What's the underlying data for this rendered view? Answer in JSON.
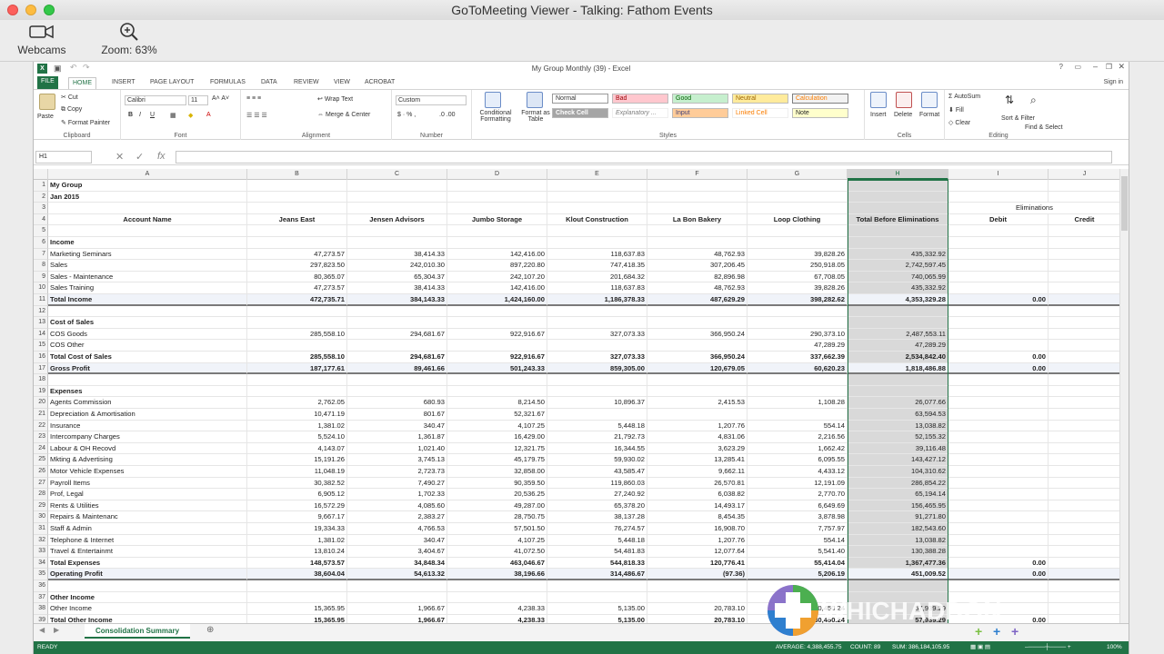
{
  "viewer": {
    "title": "GoToMeeting Viewer - Talking: Fathom Events",
    "webcams_label": "Webcams",
    "zoom_label": "Zoom: 63%"
  },
  "excel": {
    "window_title": "My Group Monthly (39) - Excel",
    "sign_in": "Sign in",
    "tabs": [
      "FILE",
      "HOME",
      "INSERT",
      "PAGE LAYOUT",
      "FORMULAS",
      "DATA",
      "REVIEW",
      "VIEW",
      "ACROBAT"
    ],
    "ribbon": {
      "clipboard": {
        "paste": "Paste",
        "cut": "Cut",
        "copy": "Copy",
        "format_painter": "Format Painter",
        "label": "Clipboard"
      },
      "font": {
        "name": "Calibri",
        "size": "11",
        "label": "Font"
      },
      "alignment": {
        "wrap": "Wrap Text",
        "merge": "Merge & Center",
        "label": "Alignment"
      },
      "number": {
        "format": "Custom",
        "label": "Number"
      },
      "styles": {
        "conditional": "Conditional Formatting",
        "format_table": "Format as Table",
        "normal": "Normal",
        "bad": "Bad",
        "good": "Good",
        "neutral": "Neutral",
        "calculation": "Calculation",
        "check_cell": "Check Cell",
        "explanatory": "Explanatory ...",
        "input": "Input",
        "linked_cell": "Linked Cell",
        "note": "Note",
        "label": "Styles"
      },
      "cells": {
        "insert": "Insert",
        "delete": "Delete",
        "format": "Format",
        "label": "Cells"
      },
      "editing": {
        "autosum": "AutoSum",
        "fill": "Fill",
        "clear": "Clear",
        "sort": "Sort & Filter",
        "find": "Find & Select",
        "label": "Editing"
      }
    },
    "name_box": "H1",
    "columns": [
      "A",
      "B",
      "C",
      "D",
      "E",
      "F",
      "G",
      "H",
      "I",
      "J"
    ],
    "rows": [
      {
        "n": "1",
        "a": "My Group",
        "bold": true
      },
      {
        "n": "2",
        "a": "Jan 2015",
        "bold": true
      },
      {
        "n": "3",
        "i": "Eliminations"
      },
      {
        "n": "4",
        "a": "Account Name",
        "b": "Jeans East",
        "c": "Jensen Advisors",
        "d": "Jumbo Storage",
        "e": "Klout Construction",
        "f": "La Bon Bakery",
        "g": "Loop Clothing",
        "h": "Total Before Eliminations",
        "i": "Debit",
        "j": "Credit",
        "bold": true,
        "header": true
      },
      {
        "n": "5"
      },
      {
        "n": "6",
        "a": "Income",
        "bold": true
      },
      {
        "n": "7",
        "a": "Marketing Seminars",
        "b": "47,273.57",
        "c": "38,414.33",
        "d": "142,416.00",
        "e": "118,637.83",
        "f": "48,762.93",
        "g": "39,828.26",
        "h": "435,332.92"
      },
      {
        "n": "8",
        "a": "Sales",
        "b": "297,823.50",
        "c": "242,010.30",
        "d": "897,220.80",
        "e": "747,418.35",
        "f": "307,206.45",
        "g": "250,918.05",
        "h": "2,742,597.45"
      },
      {
        "n": "9",
        "a": "Sales - Maintenance",
        "b": "80,365.07",
        "c": "65,304.37",
        "d": "242,107.20",
        "e": "201,684.32",
        "f": "82,896.98",
        "g": "67,708.05",
        "h": "740,065.99"
      },
      {
        "n": "10",
        "a": "Sales Training",
        "b": "47,273.57",
        "c": "38,414.33",
        "d": "142,416.00",
        "e": "118,637.83",
        "f": "48,762.93",
        "g": "39,828.26",
        "h": "435,332.92"
      },
      {
        "n": "11",
        "a": "Total Income",
        "b": "472,735.71",
        "c": "384,143.33",
        "d": "1,424,160.00",
        "e": "1,186,378.33",
        "f": "487,629.29",
        "g": "398,282.62",
        "h": "4,353,329.28",
        "i": "0.00",
        "bold": true,
        "total": true
      },
      {
        "n": "12"
      },
      {
        "n": "13",
        "a": "Cost of Sales",
        "bold": true
      },
      {
        "n": "14",
        "a": "COS Goods",
        "b": "285,558.10",
        "c": "294,681.67",
        "d": "922,916.67",
        "e": "327,073.33",
        "f": "366,950.24",
        "g": "290,373.10",
        "h": "2,487,553.11"
      },
      {
        "n": "15",
        "a": "COS Other",
        "g": "47,289.29",
        "h": "47,289.29"
      },
      {
        "n": "16",
        "a": "Total Cost of Sales",
        "b": "285,558.10",
        "c": "294,681.67",
        "d": "922,916.67",
        "e": "327,073.33",
        "f": "366,950.24",
        "g": "337,662.39",
        "h": "2,534,842.40",
        "i": "0.00",
        "bold": true
      },
      {
        "n": "17",
        "a": "Gross Profit",
        "b": "187,177.61",
        "c": "89,461.66",
        "d": "501,243.33",
        "e": "859,305.00",
        "f": "120,679.05",
        "g": "60,620.23",
        "h": "1,818,486.88",
        "i": "0.00",
        "bold": true,
        "total": true
      },
      {
        "n": "18"
      },
      {
        "n": "19",
        "a": "Expenses",
        "bold": true
      },
      {
        "n": "20",
        "a": "Agents Commission",
        "b": "2,762.05",
        "c": "680.93",
        "d": "8,214.50",
        "e": "10,896.37",
        "f": "2,415.53",
        "g": "1,108.28",
        "h": "26,077.66"
      },
      {
        "n": "21",
        "a": "Depreciation & Amortisation",
        "b": "10,471.19",
        "c": "801.67",
        "d": "52,321.67",
        "h": "63,594.53"
      },
      {
        "n": "22",
        "a": "Insurance",
        "b": "1,381.02",
        "c": "340.47",
        "d": "4,107.25",
        "e": "5,448.18",
        "f": "1,207.76",
        "g": "554.14",
        "h": "13,038.82"
      },
      {
        "n": "23",
        "a": "Intercompany Charges",
        "b": "5,524.10",
        "c": "1,361.87",
        "d": "16,429.00",
        "e": "21,792.73",
        "f": "4,831.06",
        "g": "2,216.56",
        "h": "52,155.32"
      },
      {
        "n": "24",
        "a": "Labour & OH Recovd",
        "b": "4,143.07",
        "c": "1,021.40",
        "d": "12,321.75",
        "e": "16,344.55",
        "f": "3,623.29",
        "g": "1,662.42",
        "h": "39,116.48"
      },
      {
        "n": "25",
        "a": "Mkting & Advertising",
        "b": "15,191.26",
        "c": "3,745.13",
        "d": "45,179.75",
        "e": "59,930.02",
        "f": "13,285.41",
        "g": "6,095.55",
        "h": "143,427.12"
      },
      {
        "n": "26",
        "a": "Motor Vehicle Expenses",
        "b": "11,048.19",
        "c": "2,723.73",
        "d": "32,858.00",
        "e": "43,585.47",
        "f": "9,662.11",
        "g": "4,433.12",
        "h": "104,310.62"
      },
      {
        "n": "27",
        "a": "Payroll Items",
        "b": "30,382.52",
        "c": "7,490.27",
        "d": "90,359.50",
        "e": "119,860.03",
        "f": "26,570.81",
        "g": "12,191.09",
        "h": "286,854.22"
      },
      {
        "n": "28",
        "a": "Prof, Legal",
        "b": "6,905.12",
        "c": "1,702.33",
        "d": "20,536.25",
        "e": "27,240.92",
        "f": "6,038.82",
        "g": "2,770.70",
        "h": "65,194.14"
      },
      {
        "n": "29",
        "a": "Rents & Utilities",
        "b": "16,572.29",
        "c": "4,085.60",
        "d": "49,287.00",
        "e": "65,378.20",
        "f": "14,493.17",
        "g": "6,649.69",
        "h": "156,465.95"
      },
      {
        "n": "30",
        "a": "Repairs & Maintenanc",
        "b": "9,667.17",
        "c": "2,383.27",
        "d": "28,750.75",
        "e": "38,137.28",
        "f": "8,454.35",
        "g": "3,878.98",
        "h": "91,271.80"
      },
      {
        "n": "31",
        "a": "Staff & Admin",
        "b": "19,334.33",
        "c": "4,766.53",
        "d": "57,501.50",
        "e": "76,274.57",
        "f": "16,908.70",
        "g": "7,757.97",
        "h": "182,543.60"
      },
      {
        "n": "32",
        "a": "Telephone & Internet",
        "b": "1,381.02",
        "c": "340.47",
        "d": "4,107.25",
        "e": "5,448.18",
        "f": "1,207.76",
        "g": "554.14",
        "h": "13,038.82"
      },
      {
        "n": "33",
        "a": "Travel & Entertainmt",
        "b": "13,810.24",
        "c": "3,404.67",
        "d": "41,072.50",
        "e": "54,481.83",
        "f": "12,077.64",
        "g": "5,541.40",
        "h": "130,388.28"
      },
      {
        "n": "34",
        "a": "Total Expenses",
        "b": "148,573.57",
        "c": "34,848.34",
        "d": "463,046.67",
        "e": "544,818.33",
        "f": "120,776.41",
        "g": "55,414.04",
        "h": "1,367,477.36",
        "i": "0.00",
        "bold": true
      },
      {
        "n": "35",
        "a": "Operating Profit",
        "b": "38,604.04",
        "c": "54,613.32",
        "d": "38,196.66",
        "e": "314,486.67",
        "f": "(97.36)",
        "g": "5,206.19",
        "h": "451,009.52",
        "i": "0.00",
        "bold": true,
        "total": true
      },
      {
        "n": "36"
      },
      {
        "n": "37",
        "a": "Other Income",
        "bold": true
      },
      {
        "n": "38",
        "a": "Other Income",
        "b": "15,365.95",
        "c": "1,966.67",
        "d": "4,238.33",
        "e": "5,135.00",
        "f": "20,783.10",
        "g": "30,450.24",
        "h": "57,939.29"
      },
      {
        "n": "39",
        "a": "Total Other Income",
        "b": "15,365.95",
        "c": "1,966.67",
        "d": "4,238.33",
        "e": "5,135.00",
        "f": "20,783.10",
        "g": "30,450.24",
        "h": "57,939.29",
        "i": "0.00",
        "bold": true
      }
    ],
    "sheet_tab": "Consolidation Summary",
    "status": {
      "ready": "READY",
      "average": "AVERAGE: 4,388,455.75",
      "count": "COUNT: 89",
      "sum": "SUM: 386,184,105.95",
      "zoom": "100%"
    }
  },
  "watermark": {
    "text": "WHICHADDON"
  }
}
